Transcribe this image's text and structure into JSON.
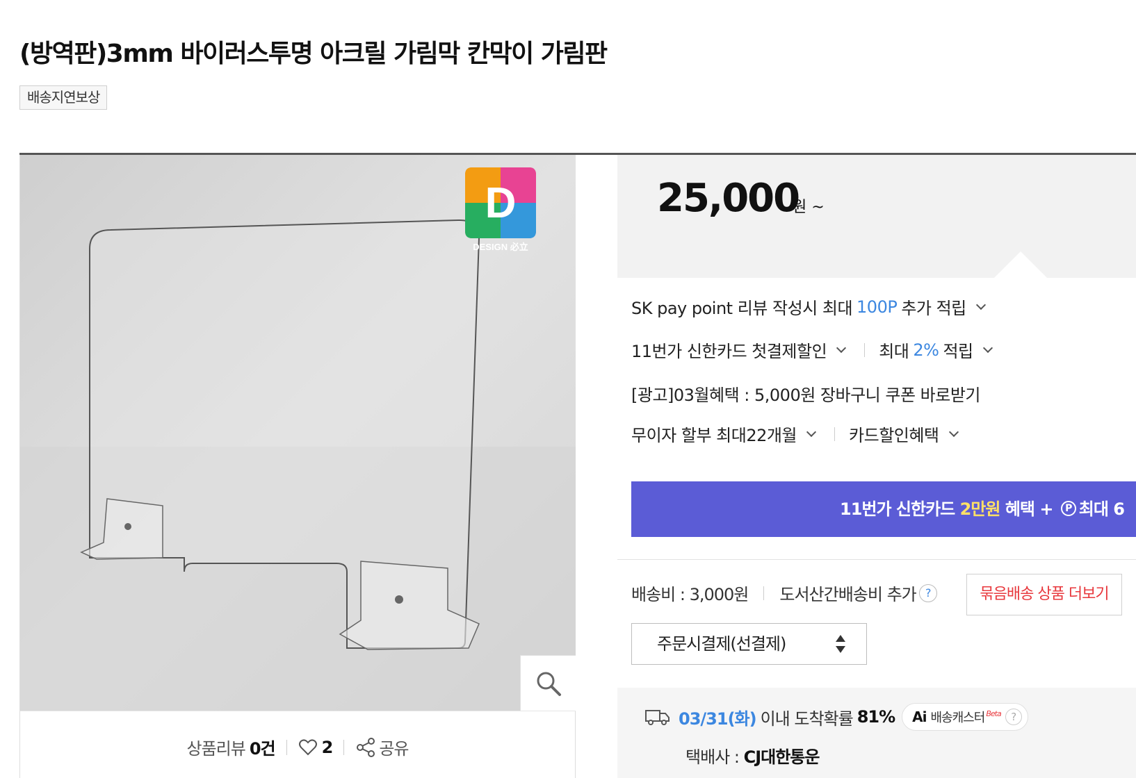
{
  "product": {
    "title": "(방역판)3mm 바이러스투명 아크릴 가림막 칸막이 가림판",
    "badge": "배송지연보상"
  },
  "image": {
    "logo_text": "DESIGN 必立",
    "logo_letter": "D"
  },
  "footer": {
    "review_label": "상품리뷰",
    "review_count": "0건",
    "like_count": "2",
    "share_label": "공유"
  },
  "price": {
    "value": "25,000",
    "unit": "원 ~"
  },
  "benefits": {
    "sk_pre": "SK pay point 리뷰 작성시 최대",
    "sk_highlight": "100P",
    "sk_post": "추가 적립",
    "card_label": "11번가 신한카드 첫결제할인",
    "card_max_pre": "최대",
    "card_max_highlight": "2%",
    "card_max_post": "적립",
    "ad_text": "[광고]03월혜택 : 5,000원 장바구니 쿠폰 바로받기",
    "installment_label": "무이자 할부 최대22개월",
    "card_discount_label": "카드할인혜택"
  },
  "banner": {
    "pre": "11번가 신한카드",
    "highlight": "2만원",
    "mid": "혜택 +",
    "p_icon": "P",
    "post": "최대 6"
  },
  "shipping": {
    "fee": "배송비 : 3,000원",
    "extra": "도서산간배송비 추가",
    "help": "?",
    "bundle_button": "묶음배송 상품 더보기",
    "select_value": "주문시결제(선결제)"
  },
  "arrival": {
    "date": "03/31(화)",
    "text": "이내 도착확률",
    "probability": "81%",
    "ai_label": "Ai",
    "caster_label": "배송캐스터",
    "beta": "Beta",
    "help": "?",
    "carrier_label": "택배사 :",
    "carrier_name": "CJ대한통운"
  },
  "colors": {
    "accent_blue": "#3c87e0",
    "banner_purple": "#5b5cd6",
    "highlight_yellow": "#ffe066",
    "red": "#e8383d"
  }
}
